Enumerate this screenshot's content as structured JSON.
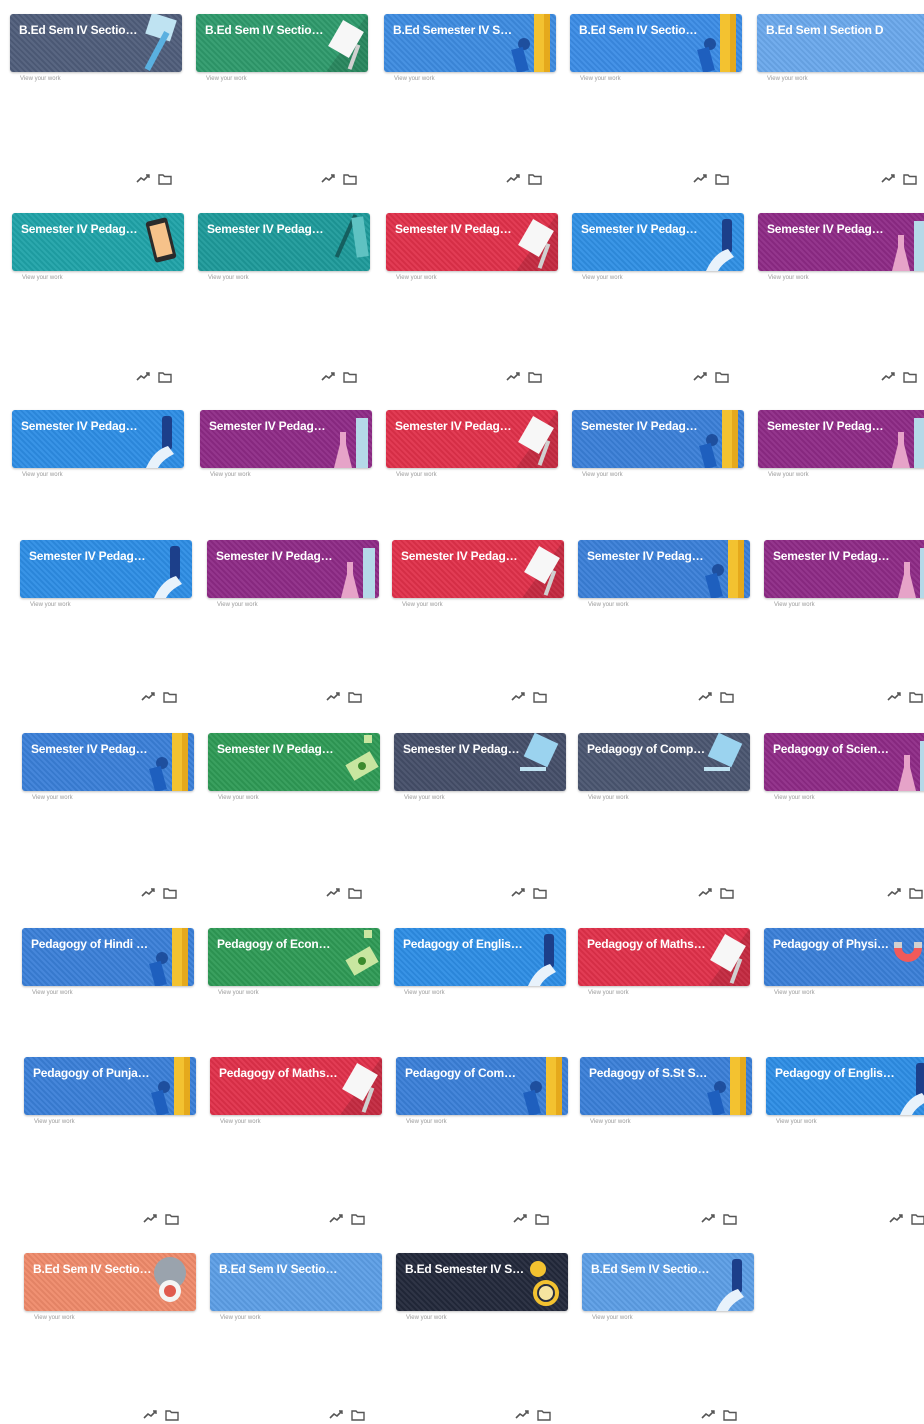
{
  "footer_text": "View your work",
  "icons": {
    "trend": "trending-icon",
    "folder": "folder-icon"
  },
  "classes": [
    {
      "title": "B.Ed Sem IV Section B",
      "subtitle": "",
      "color": "#4f5d7a",
      "illustration": "pencil"
    },
    {
      "title": "B.Ed Sem IV Section B",
      "subtitle": "",
      "color": "#2e9a6b",
      "illustration": "paper"
    },
    {
      "title": "B.Ed Semester IV Sec...",
      "subtitle": "",
      "color": "#3d8be0",
      "illustration": "pencil-yellow"
    },
    {
      "title": "B.Ed Sem IV Section A",
      "subtitle": "",
      "color": "#3b8ce6",
      "illustration": "pencil-yellow"
    },
    {
      "title": "B.Ed Sem I Section D",
      "subtitle": "",
      "color": "#6aa8ec",
      "illustration": "none"
    },
    {
      "title": "Semester IV Pedagog...",
      "subtitle": "",
      "color": "#1fa3a8",
      "illustration": "phone"
    },
    {
      "title": "Semester IV Pedagog...",
      "subtitle": "",
      "color": "#1d9a9a",
      "illustration": "pen"
    },
    {
      "title": "Semester IV Pedagog...",
      "subtitle": "",
      "color": "#e0304a",
      "illustration": "paper"
    },
    {
      "title": "Semester IV Pedagog...",
      "subtitle": "",
      "color": "#2f8fe4",
      "illustration": "pencil-blue"
    },
    {
      "title": "Semester IV Pedagog...",
      "subtitle": "",
      "color": "#8e2a86",
      "illustration": "flask"
    },
    {
      "title": "Semester IV Pedagog...",
      "subtitle": "",
      "color": "#2d8de5",
      "illustration": "pencil-blue"
    },
    {
      "title": "Semester IV Pedagog...",
      "subtitle": "",
      "color": "#8e2a86",
      "illustration": "flask"
    },
    {
      "title": "Semester IV Pedagog...",
      "subtitle": "",
      "color": "#e0304a",
      "illustration": "paper"
    },
    {
      "title": "Semester IV Pedagog...",
      "subtitle": "",
      "color": "#3a7fd8",
      "illustration": "pencil-yellow"
    },
    {
      "title": "Semester IV Pedagog...",
      "subtitle": "",
      "color": "#8e2a86",
      "illustration": "flask"
    },
    {
      "title": "Semester IV Pedagog...",
      "subtitle": "",
      "color": "#2d8de5",
      "illustration": "pencil-blue"
    },
    {
      "title": "Semester IV Pedagog...",
      "subtitle": "",
      "color": "#8e2a86",
      "illustration": "flask"
    },
    {
      "title": "Semester IV Pedagog...",
      "subtitle": "",
      "color": "#e0304a",
      "illustration": "paper"
    },
    {
      "title": "Semester IV Pedagog...",
      "subtitle": "",
      "color": "#3a7fd8",
      "illustration": "pencil-yellow"
    },
    {
      "title": "Semester IV Pedagog...",
      "subtitle": "",
      "color": "#8e2a86",
      "illustration": "flask"
    },
    {
      "title": "Semester IV Pedagog...",
      "subtitle": "",
      "color": "#3a7fd8",
      "illustration": "pencil-yellow"
    },
    {
      "title": "Semester IV Pedagog...",
      "subtitle": "",
      "color": "#2e9a55",
      "illustration": "money"
    },
    {
      "title": "Semester IV Pedagog...",
      "subtitle": "",
      "color": "#444e68",
      "illustration": "paper-blue"
    },
    {
      "title": "Pedagogy of Comput...",
      "subtitle": "",
      "color": "#4a5570",
      "illustration": "paper-blue"
    },
    {
      "title": "Pedagogy of Science...",
      "subtitle": "",
      "color": "#8e2a86",
      "illustration": "flask"
    },
    {
      "title": "Pedagogy of Hindi Se...",
      "subtitle": "",
      "color": "#3a7fd8",
      "illustration": "pencil-yellow"
    },
    {
      "title": "Pedagogy of Econom...",
      "subtitle": "",
      "color": "#2e9a55",
      "illustration": "money"
    },
    {
      "title": "Pedagogy of English ...",
      "subtitle": "",
      "color": "#2d8de5",
      "illustration": "pencil-blue"
    },
    {
      "title": "Pedagogy of Maths S...",
      "subtitle": "",
      "color": "#e0304a",
      "illustration": "paper"
    },
    {
      "title": "Pedagogy of Physics...",
      "subtitle": "",
      "color": "#3a7fd8",
      "illustration": "magnet"
    },
    {
      "title": "Pedagogy of Punjabi...",
      "subtitle": "",
      "color": "#3a7fd8",
      "illustration": "pencil-yellow"
    },
    {
      "title": "Pedagogy of Maths S...",
      "subtitle": "",
      "color": "#e0304a",
      "illustration": "paper"
    },
    {
      "title": "Pedagogy of Comme...",
      "subtitle": "",
      "color": "#3a7fd8",
      "illustration": "pencil-yellow"
    },
    {
      "title": "Pedagogy of S.St Se...",
      "subtitle": "",
      "color": "#3a7fd8",
      "illustration": "pencil-yellow"
    },
    {
      "title": "Pedagogy of English ...",
      "subtitle": "",
      "color": "#2d8de5",
      "illustration": "pencil-blue"
    },
    {
      "title": "B.Ed Sem IV Section C",
      "subtitle": "",
      "color": "#ef8a6a",
      "illustration": "gear"
    },
    {
      "title": "B.Ed Sem IV Section A",
      "subtitle": "",
      "color": "#5c9ee6",
      "illustration": "none"
    },
    {
      "title": "B.Ed Semester IV Sec...",
      "subtitle": "",
      "color": "#22283a",
      "illustration": "search"
    },
    {
      "title": "B.Ed Sem IV Section C",
      "subtitle": "",
      "color": "#5c9ee6",
      "illustration": "pencil-blue"
    }
  ]
}
